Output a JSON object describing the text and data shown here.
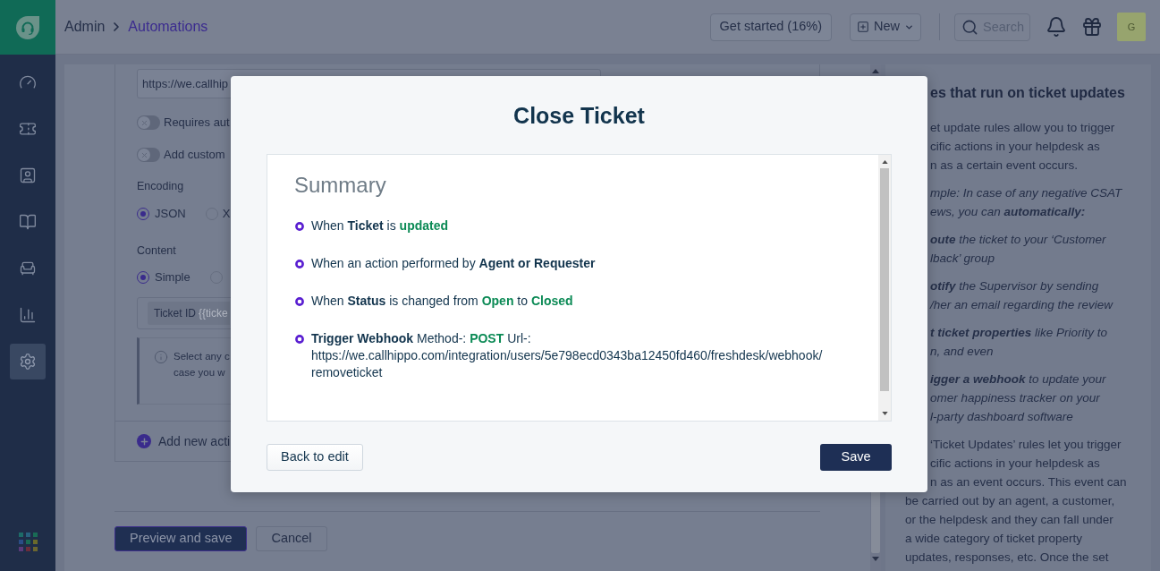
{
  "sidebar": {
    "items": [
      {
        "selected": false
      },
      {
        "selected": false
      },
      {
        "selected": false
      },
      {
        "selected": false
      },
      {
        "selected": false
      },
      {
        "selected": false
      },
      {
        "selected": true
      }
    ]
  },
  "top_bar": {
    "breadcrumb": [
      {
        "label": "Admin",
        "current": false
      },
      {
        "label": "Automations",
        "current": true
      }
    ],
    "get_started": "Get started (16%)",
    "new_button": "New",
    "search": {
      "placeholder": "Search"
    },
    "avatar": "G"
  },
  "form": {
    "url_field": {
      "value": "https://we.callhip"
    },
    "toggles": [
      {
        "label": "Requires aut",
        "on": false
      },
      {
        "label": "Add custom",
        "on": false
      }
    ],
    "radio_groups": [
      {
        "label": "Encoding",
        "options": [
          {
            "label": "JSON",
            "selected": true
          },
          {
            "label": "X",
            "selected": false
          }
        ]
      },
      {
        "label": "Content",
        "options": [
          {
            "label": "Simple",
            "selected": true
          },
          {
            "selected": false
          }
        ]
      }
    ],
    "content_field": {
      "label": "Ticket ID",
      "token": "{{ticke"
    },
    "info_lines": [
      "Select any c",
      "case you w"
    ],
    "add_action": "Add new acti"
  },
  "form_buttons": [
    {
      "label": "Preview and save",
      "kind": "primary"
    },
    {
      "label": "Cancel",
      "kind": "secondary"
    }
  ],
  "help_panel": {
    "title": "es that run on ticket updates",
    "paragraphs": [
      {
        "kind": "text",
        "lines": [
          {
            "text": "et update rules allow you to trigger",
            "kind": "cut"
          },
          {
            "text": "cific actions in your helpdesk as",
            "kind": "cut"
          },
          {
            "text": "n as a certain event occurs.",
            "kind": "cut"
          }
        ]
      },
      {
        "kind": "example",
        "lines": [
          {
            "text": "mple: In case of any negative CSAT",
            "kind": "cut"
          },
          {
            "text": "ews, you can **automatically:**",
            "kind": "cut"
          }
        ]
      },
      {
        "kind": "example",
        "lines": [
          {
            "text": "**oute** the ticket to your ‘Customer",
            "kind": "cut"
          },
          {
            "text": "lback’ group",
            "kind": "cut"
          }
        ]
      },
      {
        "kind": "example",
        "lines": [
          {
            "text": "**otify** the Supervisor by sending",
            "kind": "cut"
          },
          {
            "text": "/her an email regarding the review",
            "kind": "cut"
          }
        ]
      },
      {
        "kind": "example",
        "lines": [
          {
            "text": "**t ticket properties** like Priority to",
            "kind": "cut"
          },
          {
            "text": "n, and even",
            "kind": "cut"
          }
        ]
      },
      {
        "kind": "example",
        "lines": [
          {
            "text": "**igger a webhook** to update your",
            "kind": "cut"
          },
          {
            "text": "omer happiness tracker on your",
            "kind": "cut"
          },
          {
            "text": "l-party dashboard software",
            "kind": "cut"
          }
        ]
      },
      {
        "kind": "text",
        "lines": [
          {
            "text": "‘Ticket Updates’ rules let you trigger",
            "kind": "cut"
          },
          {
            "text": "cific actions in your helpdesk as",
            "kind": "cut"
          },
          {
            "text": "n as an event occurs. This event can",
            "kind": "cut"
          },
          {
            "text": "be carried out by an agent, a customer,",
            "kind": "full"
          },
          {
            "text": "or the helpdesk and they can fall under",
            "kind": "full"
          },
          {
            "text": "a wide category of ticket property",
            "kind": "full"
          },
          {
            "text": "updates, responses, etc. Once the set",
            "kind": "full"
          }
        ]
      }
    ]
  },
  "modal": {
    "title": "Close Ticket",
    "summary": {
      "heading": "Summary",
      "items": [
        {
          "segments": [
            {
              "kind": "text",
              "text": "When "
            },
            {
              "kind": "bold",
              "text": "Ticket"
            },
            {
              "kind": "text",
              "text": " is "
            },
            {
              "kind": "value",
              "text": "updated"
            }
          ]
        },
        {
          "segments": [
            {
              "kind": "text",
              "text": "When an action performed by "
            },
            {
              "kind": "bold",
              "text": "Agent or Requester"
            }
          ]
        },
        {
          "segments": [
            {
              "kind": "text",
              "text": "When "
            },
            {
              "kind": "bold",
              "text": "Status"
            },
            {
              "kind": "text",
              "text": " is changed from "
            },
            {
              "kind": "value",
              "text": "Open"
            },
            {
              "kind": "text",
              "text": " to "
            },
            {
              "kind": "value",
              "text": "Closed"
            }
          ]
        },
        {
          "segments": [
            {
              "kind": "bold",
              "text": "Trigger Webhook"
            },
            {
              "kind": "text",
              "text": " Method-: "
            },
            {
              "kind": "value",
              "text": "POST"
            },
            {
              "kind": "text",
              "text": " Url-: "
            },
            {
              "kind": "url",
              "text": "https://we.callhippo.com/integration/users/5e798ecd0343ba12450fd460/freshdesk/webhook/removeticket"
            }
          ]
        }
      ]
    },
    "buttons": [
      {
        "label": "Back to edit",
        "kind": "secondary"
      },
      {
        "label": "Save",
        "kind": "primary"
      }
    ]
  }
}
